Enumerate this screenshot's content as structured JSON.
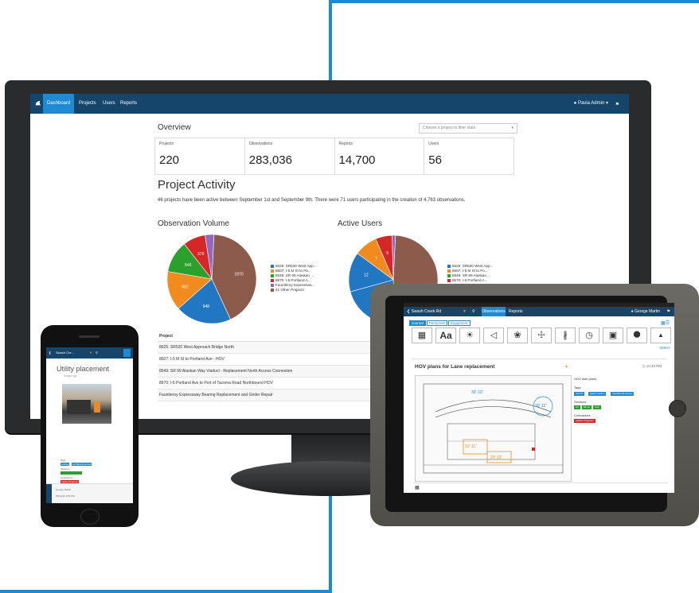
{
  "colors": {
    "nav": "#16456c",
    "accent": "#1f8ad1",
    "frame": "#1f8ad1"
  },
  "monitor": {
    "nav": {
      "items": [
        "Dashboard",
        "Projects",
        "Users",
        "Reports"
      ],
      "admin": "Pavia Admin"
    },
    "overview": {
      "title": "Overview",
      "select_placeholder": "Choose a project to filter stats",
      "stats": [
        {
          "label": "Projects",
          "value": "220"
        },
        {
          "label": "Observations",
          "value": "283,036"
        },
        {
          "label": "Reports",
          "value": "14,700"
        },
        {
          "label": "Users",
          "value": "56"
        }
      ]
    },
    "activity": {
      "title": "Project Activity",
      "text": "46 projects have been active between September 1st and September 9th. There were 71 users participating in the creation of 4,763 observations."
    },
    "obs_volume": {
      "title": "Observation Volume",
      "slices": [
        {
          "value": 1970,
          "label": "1970",
          "color": "#8d5b4c"
        },
        {
          "value": 948,
          "label": "948",
          "color": "#2277c2"
        },
        {
          "value": 662,
          "label": "662",
          "color": "#f28b1e"
        },
        {
          "value": 546,
          "label": "546",
          "color": "#2ca02c"
        },
        {
          "value": 379,
          "label": "379",
          "color": "#d62728"
        },
        {
          "value": 150,
          "label": "",
          "color": "#9467bd"
        }
      ]
    },
    "active_users": {
      "title": "Active Users",
      "slices": [
        {
          "value": 40,
          "label": "",
          "color": "#8d5b4c"
        },
        {
          "value": 18,
          "label": "",
          "color": "#2277c2"
        },
        {
          "value": 12,
          "label": "12",
          "color": "#2277c2"
        },
        {
          "value": 7,
          "label": "7",
          "color": "#f28b1e"
        },
        {
          "value": 5,
          "label": "5",
          "color": "#d62728"
        },
        {
          "value": 1,
          "label": "",
          "color": "#9467bd"
        }
      ]
    },
    "legend": [
      {
        "label": "8625: SR520 West App...",
        "color": "#2277c2"
      },
      {
        "label": "8607: I-5 M St to Po...",
        "color": "#f28b1e"
      },
      {
        "label": "8549: SR 99 Alaskan ...",
        "color": "#2ca02c"
      },
      {
        "label": "8670: I-5 Portland A...",
        "color": "#d62728"
      },
      {
        "label": "Fauntleroy Expresswa...",
        "color": "#9467bd"
      },
      {
        "label": "41 Other Projects",
        "color": "#8d5b4c"
      }
    ],
    "table": {
      "header": "Project",
      "rows": [
        "8625: SR520 West Approach Bridge North",
        "8607: I-5 M St to Portland Ave - HOV",
        "8549: SR 99 Alaskan Way Viaduct - Replacement North Access Connection",
        "8670: I-5 Portland Ave to Port of Tacoma Road Northbound HOV",
        "Fauntleroy Expressway Bearing Replacement and Girder Repair"
      ]
    }
  },
  "phone": {
    "nav_title": "Swash Cre...",
    "card_title": "Utility placement",
    "card_date": "8 days ago",
    "section_tags": "Tags",
    "section_sections": "Sections",
    "section_contractors": "Contractors",
    "tags": [
      "curbing",
      "northbound across"
    ],
    "contractor": "Applied Engineer",
    "user": "George Martin",
    "footer_date": "05/14/16 4:56 PM"
  },
  "tablet": {
    "nav_back": "Swash Creek Rd",
    "nav_tabs": [
      "Observations",
      "Reports"
    ],
    "user": "George Martin",
    "tabs": [
      "Journal",
      "Personnel",
      "Equipment"
    ],
    "select": "Select",
    "card_title": "HOV plans for Lane replacement",
    "time": "12:44 PM",
    "right_title": "HOV lane plans",
    "right_tags": "Tags",
    "right_sections": "Sections",
    "right_contractors": "Contractors",
    "tag_values": [
      "curb fit",
      "grade control",
      "northbound access"
    ],
    "section_values": [
      "1A",
      "8A-13",
      "C12"
    ],
    "contractor_value": "Applied Engineer",
    "dims": [
      "30' 10\"",
      "30' 11\"",
      "10' 11\"",
      "20' 10\""
    ]
  }
}
